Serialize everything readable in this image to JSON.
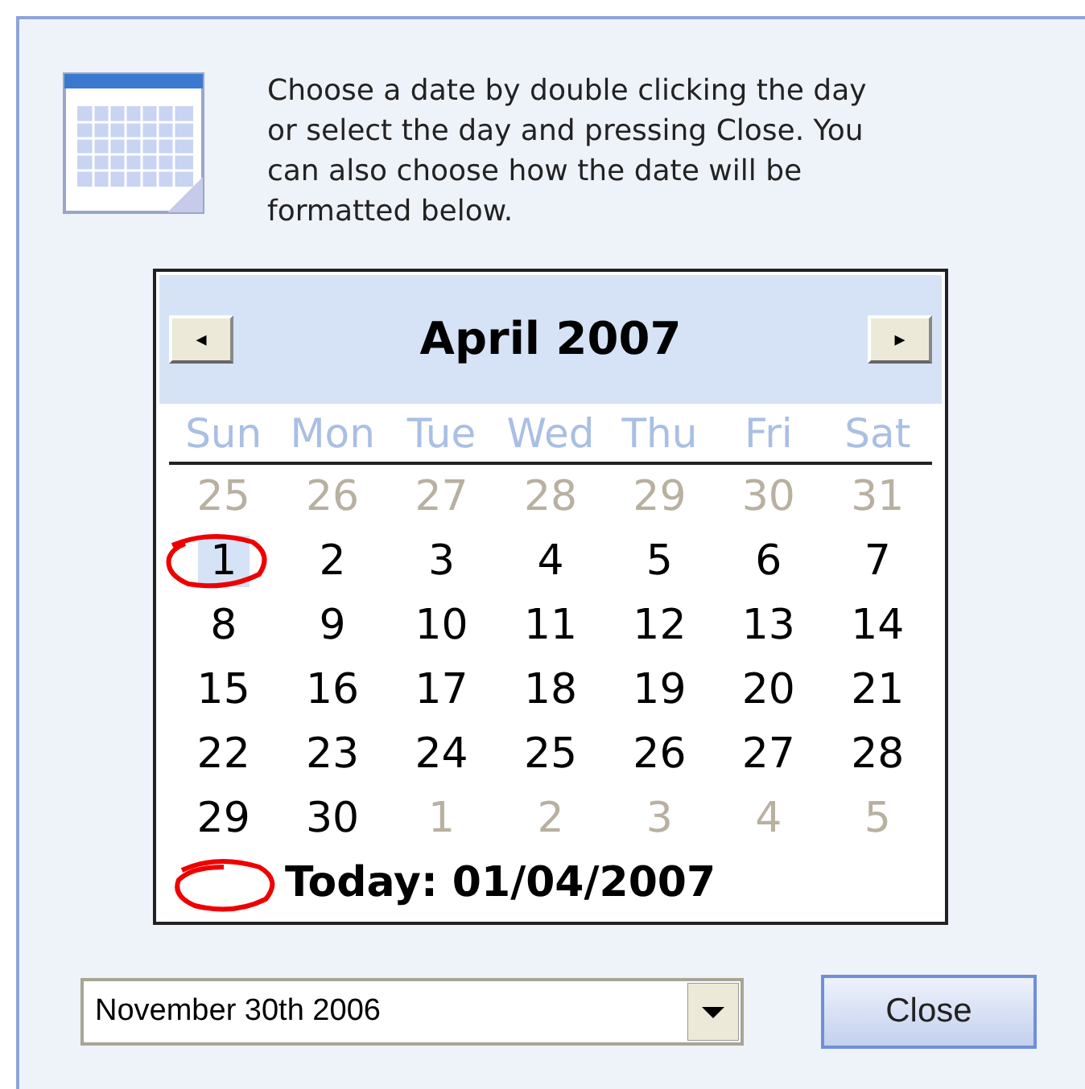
{
  "instructions": "Choose a date by double clicking the day or select the day and pressing Close. You can also choose how the date will be formatted below.",
  "calendar": {
    "prev": "◂",
    "next": "▸",
    "title": "April 2007",
    "weekdays": [
      "Sun",
      "Mon",
      "Tue",
      "Wed",
      "Thu",
      "Fri",
      "Sat"
    ],
    "weeks": [
      [
        {
          "day": "25",
          "muted": true,
          "selected": false
        },
        {
          "day": "26",
          "muted": true,
          "selected": false
        },
        {
          "day": "27",
          "muted": true,
          "selected": false
        },
        {
          "day": "28",
          "muted": true,
          "selected": false
        },
        {
          "day": "29",
          "muted": true,
          "selected": false
        },
        {
          "day": "30",
          "muted": true,
          "selected": false
        },
        {
          "day": "31",
          "muted": true,
          "selected": false
        }
      ],
      [
        {
          "day": "1",
          "muted": false,
          "selected": true
        },
        {
          "day": "2",
          "muted": false,
          "selected": false
        },
        {
          "day": "3",
          "muted": false,
          "selected": false
        },
        {
          "day": "4",
          "muted": false,
          "selected": false
        },
        {
          "day": "5",
          "muted": false,
          "selected": false
        },
        {
          "day": "6",
          "muted": false,
          "selected": false
        },
        {
          "day": "7",
          "muted": false,
          "selected": false
        }
      ],
      [
        {
          "day": "8",
          "muted": false,
          "selected": false
        },
        {
          "day": "9",
          "muted": false,
          "selected": false
        },
        {
          "day": "10",
          "muted": false,
          "selected": false
        },
        {
          "day": "11",
          "muted": false,
          "selected": false
        },
        {
          "day": "12",
          "muted": false,
          "selected": false
        },
        {
          "day": "13",
          "muted": false,
          "selected": false
        },
        {
          "day": "14",
          "muted": false,
          "selected": false
        }
      ],
      [
        {
          "day": "15",
          "muted": false,
          "selected": false
        },
        {
          "day": "16",
          "muted": false,
          "selected": false
        },
        {
          "day": "17",
          "muted": false,
          "selected": false
        },
        {
          "day": "18",
          "muted": false,
          "selected": false
        },
        {
          "day": "19",
          "muted": false,
          "selected": false
        },
        {
          "day": "20",
          "muted": false,
          "selected": false
        },
        {
          "day": "21",
          "muted": false,
          "selected": false
        }
      ],
      [
        {
          "day": "22",
          "muted": false,
          "selected": false
        },
        {
          "day": "23",
          "muted": false,
          "selected": false
        },
        {
          "day": "24",
          "muted": false,
          "selected": false
        },
        {
          "day": "25",
          "muted": false,
          "selected": false
        },
        {
          "day": "26",
          "muted": false,
          "selected": false
        },
        {
          "day": "27",
          "muted": false,
          "selected": false
        },
        {
          "day": "28",
          "muted": false,
          "selected": false
        }
      ],
      [
        {
          "day": "29",
          "muted": false,
          "selected": false
        },
        {
          "day": "30",
          "muted": false,
          "selected": false
        },
        {
          "day": "1",
          "muted": true,
          "selected": false
        },
        {
          "day": "2",
          "muted": true,
          "selected": false
        },
        {
          "day": "3",
          "muted": true,
          "selected": false
        },
        {
          "day": "4",
          "muted": true,
          "selected": false
        },
        {
          "day": "5",
          "muted": true,
          "selected": false
        }
      ]
    ],
    "today": "Today: 01/04/2007"
  },
  "format": {
    "value": "November 30th 2006"
  },
  "close_button": "Close"
}
